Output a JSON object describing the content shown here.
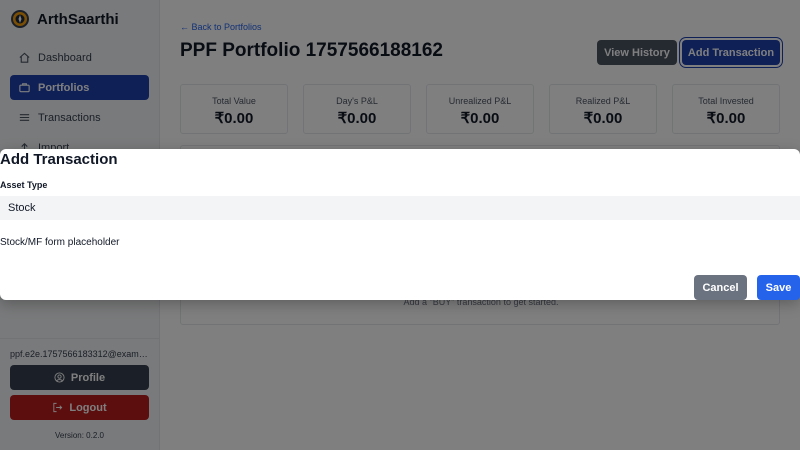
{
  "app": {
    "name": "ArthSaarthi",
    "logo_icon": "compass-logo-icon"
  },
  "sidebar": {
    "items": [
      {
        "label": "Dashboard",
        "icon": "home-icon",
        "active": false
      },
      {
        "label": "Portfolios",
        "icon": "briefcase-icon",
        "active": true
      },
      {
        "label": "Transactions",
        "icon": "list-icon",
        "active": false
      },
      {
        "label": "Import",
        "icon": "upload-icon",
        "active": false
      }
    ],
    "user_email": "ppf.e2e.1757566183312@examp...",
    "profile_label": "Profile",
    "logout_label": "Logout",
    "version": "Version: 0.2.0"
  },
  "main": {
    "back_link": "← Back to Portfolios",
    "title": "PPF Portfolio 1757566188162",
    "view_history_label": "View History",
    "add_transaction_label": "Add Transaction",
    "summary_cards": [
      {
        "label": "Total Value",
        "value": "₹0.00"
      },
      {
        "label": "Day's P&L",
        "value": "₹0.00"
      },
      {
        "label": "Unrealized P&L",
        "value": "₹0.00"
      },
      {
        "label": "Realized P&L",
        "value": "₹0.00"
      },
      {
        "label": "Total Invested",
        "value": "₹0.00"
      }
    ],
    "empty_state": "Add a \"BUY\" transaction to get started."
  },
  "modal": {
    "title": "Add Transaction",
    "asset_type_label": "Asset Type",
    "asset_type_value": "Stock",
    "placeholder_text": "Stock/MF form placeholder",
    "cancel_label": "Cancel",
    "save_label": "Save"
  },
  "colors": {
    "primary": "#1e40af",
    "save": "#2563eb",
    "logout": "#b91c1c",
    "profile": "#374151",
    "cancel": "#6b7280"
  }
}
